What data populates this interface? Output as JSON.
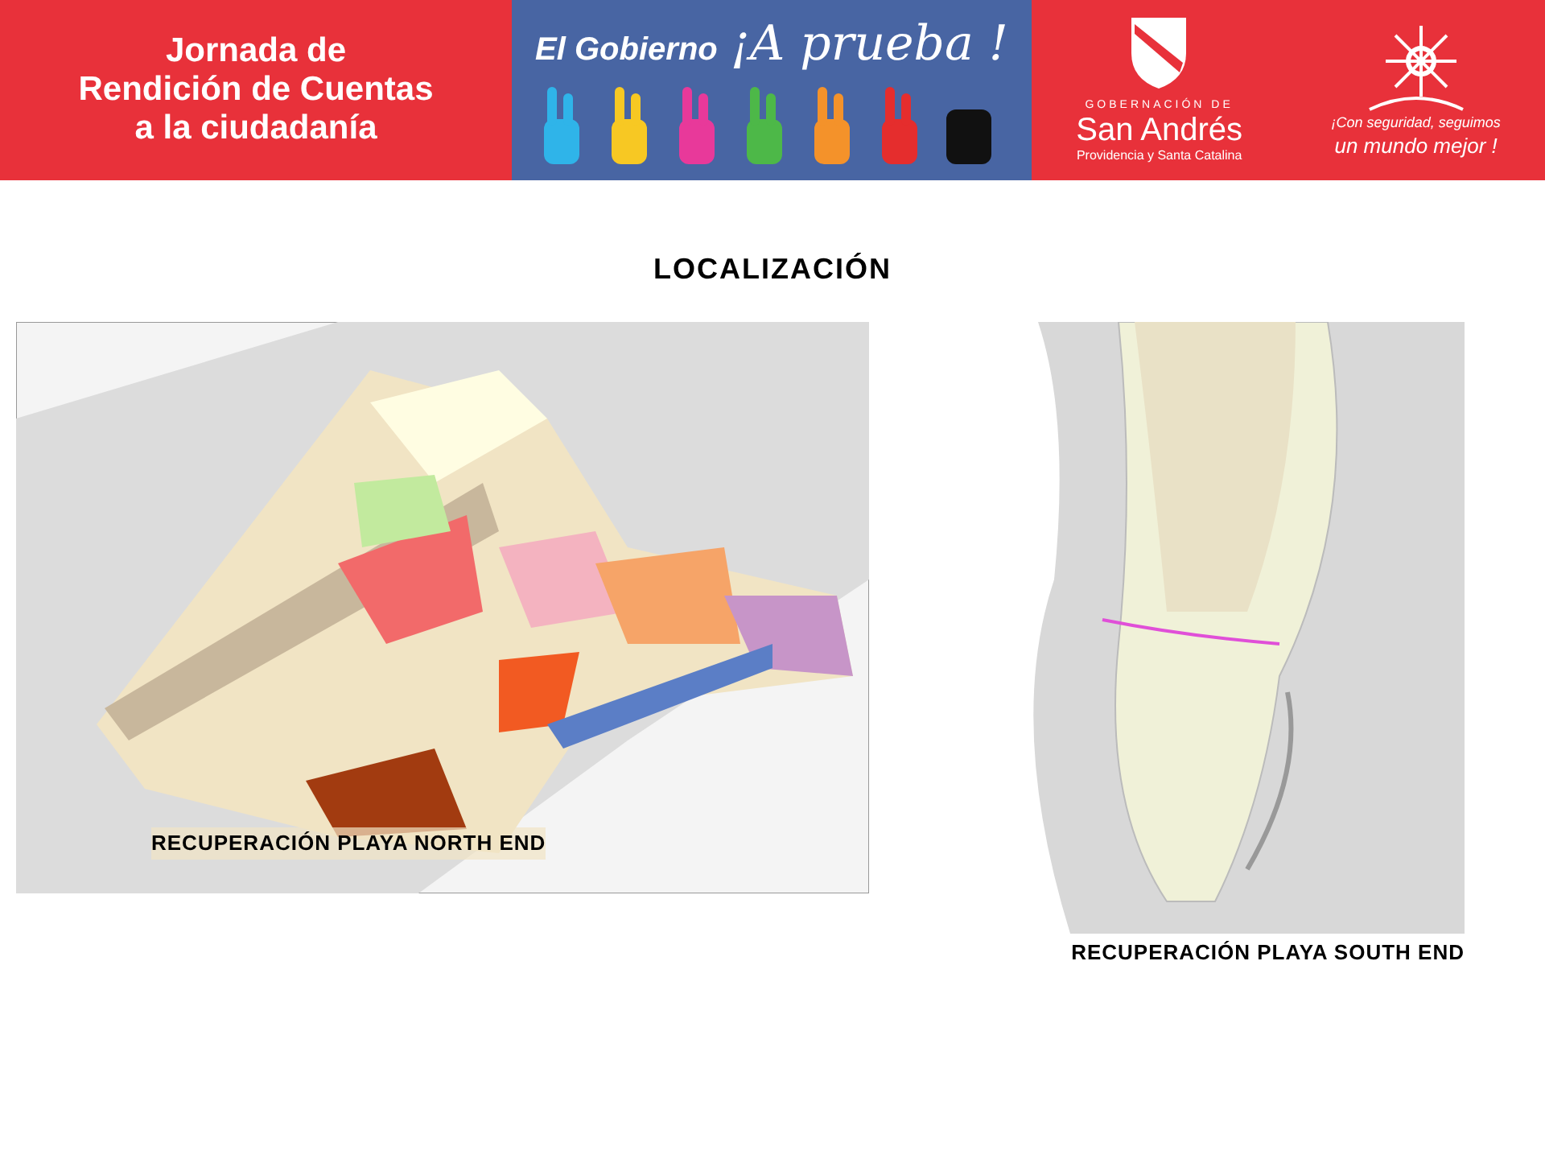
{
  "banner": {
    "title_lines": [
      "Jornada de",
      "Rendición de Cuentas",
      "a la ciudadanía"
    ],
    "campaign": {
      "lead": "El Gobierno",
      "slogan": "¡A prueba !"
    },
    "government": {
      "overline": "GOBERNACIÓN DE",
      "name": "San Andrés",
      "subline": "Providencia y Santa Catalina"
    },
    "motto": {
      "line_1": "¡Con seguridad, seguimos",
      "line_2": "un mundo mejor !"
    }
  },
  "heading": "LOCALIZACIÓN",
  "maps": [
    {
      "caption": "RECUPERACIÓN PLAYA NORTH END"
    },
    {
      "caption": "RECUPERACIÓN PLAYA SOUTH END"
    }
  ]
}
